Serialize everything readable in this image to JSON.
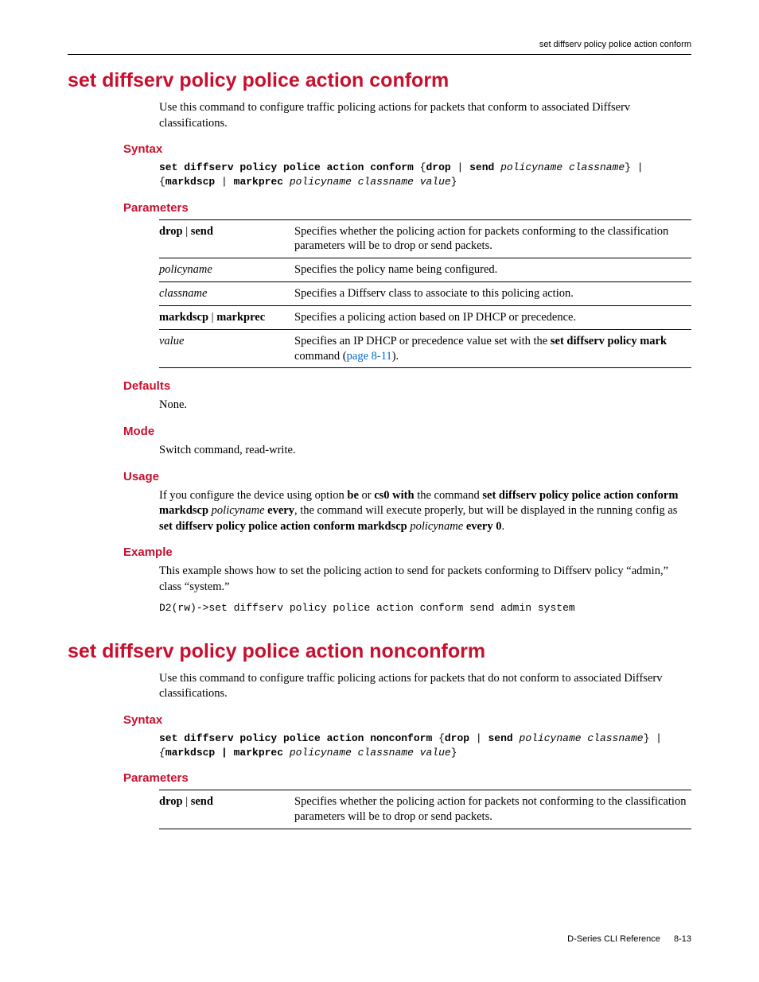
{
  "header": {
    "right": "set diffserv policy police action conform"
  },
  "section1": {
    "title": "set diffserv policy police action conform",
    "intro": "Use this command to configure traffic policing actions for packets that conform to associated Diffserv classifications.",
    "syntax_h": "Syntax",
    "syntax_line1_a": "set diffserv policy police action conform",
    "syntax_line1_b": " {",
    "syntax_line1_c": "drop",
    "syntax_line1_d": " | ",
    "syntax_line1_e": "send",
    "syntax_line1_f": " ",
    "syntax_line1_g": "policyname classname",
    "syntax_line1_h": "} | ",
    "syntax_line2_a": "{",
    "syntax_line2_b": "markdscp",
    "syntax_line2_c": " | ",
    "syntax_line2_d": "markprec",
    "syntax_line2_e": " ",
    "syntax_line2_f": "policyname classname value",
    "syntax_line2_g": "}",
    "params_h": "Parameters",
    "params": [
      {
        "name_html": "<span class='b'>drop</span> | <span class='b'>send</span>",
        "desc_html": "Specifies whether the policing action for packets conforming to the classification parameters will be to drop or send packets."
      },
      {
        "name_html": "<span class='i'>policyname</span>",
        "desc_html": "Specifies the policy name being configured."
      },
      {
        "name_html": "<span class='i'>classname</span>",
        "desc_html": "Specifies a Diffserv class to associate to this policing action."
      },
      {
        "name_html": "<span class='b'>markdscp</span> | <span class='b'>markprec</span>",
        "desc_html": "Specifies a policing action based on IP DHCP or precedence."
      },
      {
        "name_html": "<span class='i'>value</span>",
        "desc_html": "Specifies an IP DHCP or precedence value set with the <span class='b'>set diffserv policy mark</span> command (<span class='link'>page 8-11</span>)."
      }
    ],
    "defaults_h": "Defaults",
    "defaults_body": "None.",
    "mode_h": "Mode",
    "mode_body": "Switch command, read-write.",
    "usage_h": "Usage",
    "usage_body_html": "If you configure the device using option <span class='b'>be</span> or <span class='b'>cs0 with</span> the command <span class='b'>set diffserv policy police action conform markdscp</span> <span class='i'>policyname</span> <span class='b'>every</span>, the command will execute properly, but will be displayed in the running config as <span class='b'>set diffserv policy police action conform markdscp</span> <span class='i'>policyname</span> <span class='b'>every 0</span>.",
    "example_h": "Example",
    "example_intro": "This example shows how to set the policing action to  send for packets conforming to Diffserv policy “admin,” class “system.”",
    "example_code": "D2(rw)->set diffserv policy police action conform send admin system"
  },
  "section2": {
    "title": "set diffserv policy police action nonconform",
    "intro": "Use this command to configure traffic policing actions for packets that do not conform to associated Diffserv classifications.",
    "syntax_h": "Syntax",
    "syntax_line1_a": "set diffserv policy police action nonconform",
    "syntax_line1_b": " {",
    "syntax_line1_c": "drop",
    "syntax_line1_d": " | ",
    "syntax_line1_e": "send",
    "syntax_line1_f": " ",
    "syntax_line1_g": "policyname classname",
    "syntax_line1_h": "} | ",
    "syntax_line2_a": "{",
    "syntax_line2_b": "markdscp | markprec",
    "syntax_line2_e": " ",
    "syntax_line2_f": "policyname classname value",
    "syntax_line2_g": "}",
    "params_h": "Parameters",
    "params": [
      {
        "name_html": "<span class='b'>drop</span> | <span class='b'>send</span>",
        "desc_html": "Specifies whether the policing action for packets not conforming to the classification parameters will be to drop or send packets."
      }
    ]
  },
  "footer": {
    "doc": "D-Series CLI Reference",
    "page": "8-13"
  }
}
